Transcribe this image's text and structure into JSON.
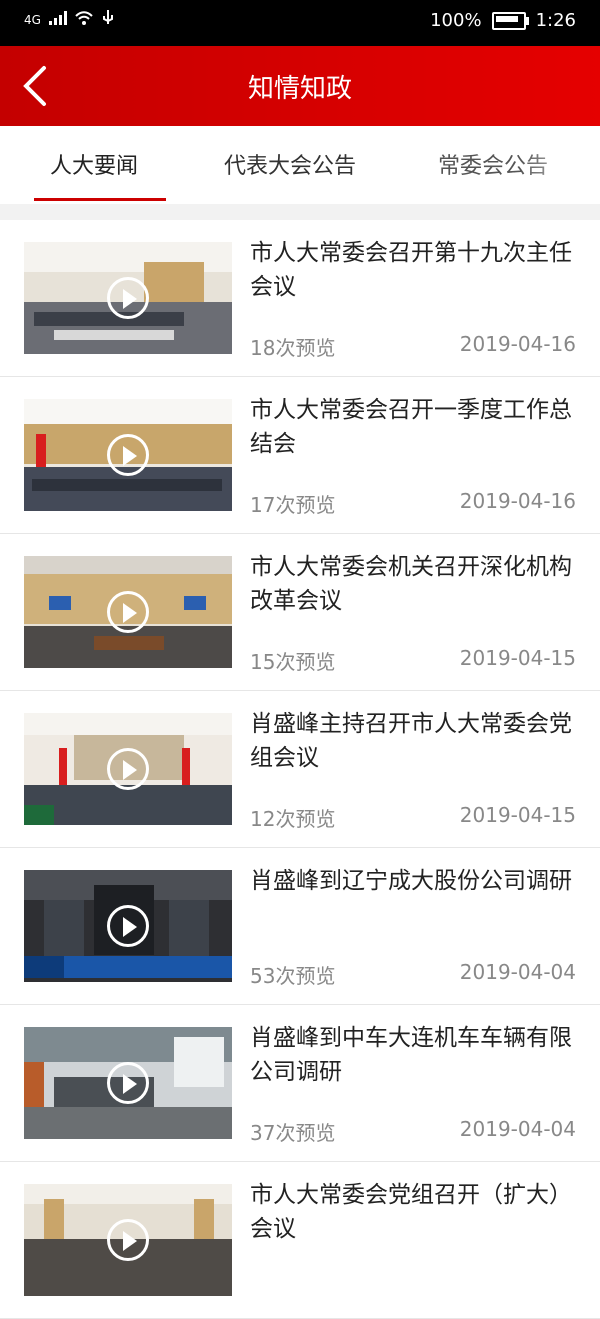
{
  "status": {
    "network": "4G",
    "battery": "100%",
    "time": "1:26"
  },
  "header": {
    "title": "知情知政"
  },
  "tabs": [
    {
      "label": "人大要闻"
    },
    {
      "label": "代表大会公告"
    },
    {
      "label": "常委会公告"
    }
  ],
  "items": [
    {
      "title": "市人大常委会召开第十九次主任会议",
      "views": "18次预览",
      "date": "2019-04-16"
    },
    {
      "title": "市人大常委会召开一季度工作总结会",
      "views": "17次预览",
      "date": "2019-04-16"
    },
    {
      "title": "市人大常委会机关召开深化机构改革会议",
      "views": "15次预览",
      "date": "2019-04-15"
    },
    {
      "title": "肖盛峰主持召开市人大常委会党组会议",
      "views": "12次预览",
      "date": "2019-04-15"
    },
    {
      "title": "肖盛峰到辽宁成大股份公司调研",
      "views": "53次预览",
      "date": "2019-04-04"
    },
    {
      "title": "肖盛峰到中车大连机车车辆有限公司调研",
      "views": "37次预览",
      "date": "2019-04-04"
    },
    {
      "title": "市人大常委会党组召开（扩大）会议",
      "views": "",
      "date": ""
    }
  ],
  "colors": {
    "primary": "#d40000",
    "tab_underline": "#cc0000"
  }
}
